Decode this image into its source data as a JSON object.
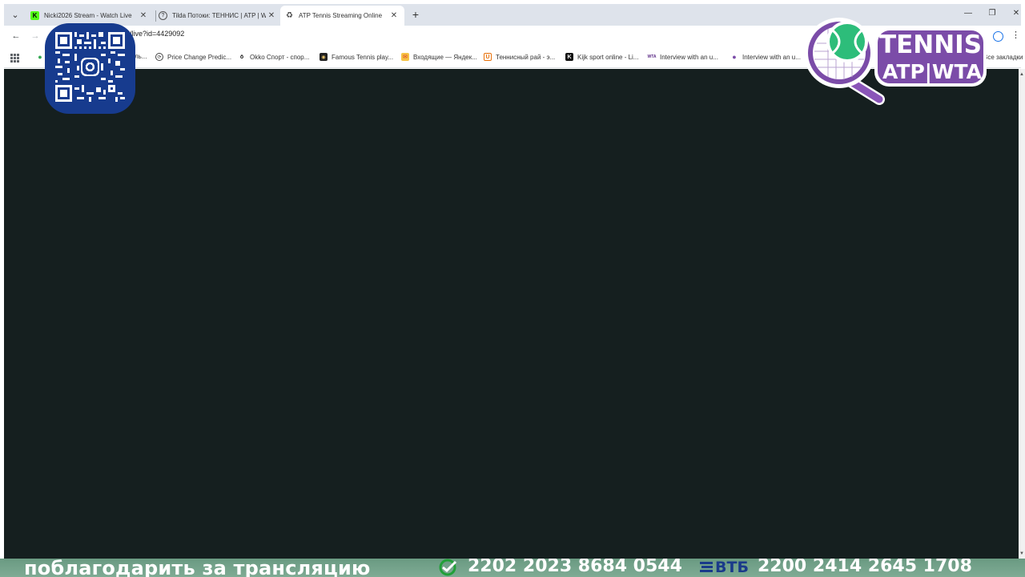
{
  "tabs": [
    {
      "title": "Nicki2026 Stream - Watch Live",
      "favicon": "kick-icon",
      "active": false
    },
    {
      "title": "Tilda Потоки: ТЕННИС | ATP | WTA",
      "favicon": "question-circle-icon",
      "active": false
    },
    {
      "title": "ATP Tennis Streaming Online",
      "favicon": "recycle-icon",
      "active": true
    }
  ],
  "address_bar": {
    "url": "/live?id=4429092"
  },
  "bookmarks": {
    "items": [
      {
        "label": "Price Change Predic...",
        "icon": "price-icon"
      },
      {
        "label": "Okko Спорт - спор...",
        "icon": "okko-icon"
      },
      {
        "label": "Famous Tennis play...",
        "icon": "tennis-player-icon"
      },
      {
        "label": "Входящие — Яндек...",
        "icon": "yandex-mail-icon"
      },
      {
        "label": "Теннисный рай - э...",
        "icon": "tennis-paradise-icon"
      },
      {
        "label": "Kijk sport online - Li...",
        "icon": "kijk-icon"
      },
      {
        "label": "Interview with an u...",
        "icon": "wta-icon"
      },
      {
        "label": "Interview with an u...",
        "icon": "interview-icon"
      }
    ],
    "partial_label": "ль...",
    "all_bookmarks": "Все закладки"
  },
  "logo": {
    "title": "TENNIS",
    "subtitle": "ATP|WTA"
  },
  "banner": {
    "text": "поблагодарить за трансляцию",
    "card1": "2202 2023 8684 0544",
    "bank2": "ВТБ",
    "card2": "2200 2414 2645 1708"
  },
  "colors": {
    "content_bg": "#151f1f",
    "tabstrip_bg": "#dee3eb",
    "banner_bg": "#74a28b",
    "qr_bg": "#173b8e",
    "logo_purple": "#7b4ca8",
    "logo_green": "#2dbd7a"
  }
}
